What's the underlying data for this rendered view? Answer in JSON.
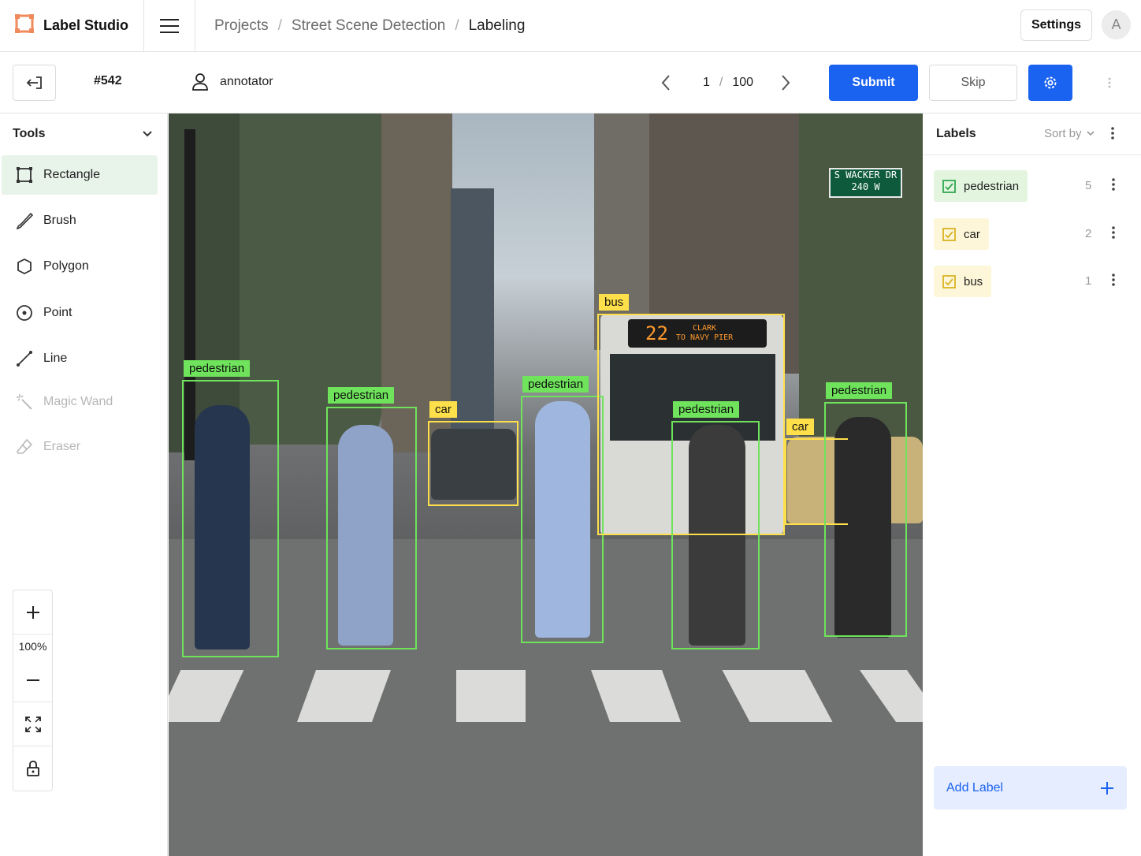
{
  "app": {
    "name": "Label Studio"
  },
  "breadcrumb": {
    "items": [
      "Projects",
      "Street Scene Detection",
      "Labeling"
    ],
    "separator": "/"
  },
  "header": {
    "settings_label": "Settings",
    "avatar_initial": "A"
  },
  "toolbar": {
    "task_id": "#542",
    "annotator": "annotator",
    "current_page": "1",
    "page_separator": "/",
    "total_pages": "100",
    "submit_label": "Submit",
    "skip_label": "Skip"
  },
  "tools": {
    "header": "Tools",
    "items": [
      {
        "label": "Rectangle",
        "icon": "rectangle-icon",
        "state": "active"
      },
      {
        "label": "Brush",
        "icon": "brush-icon",
        "state": "normal"
      },
      {
        "label": "Polygon",
        "icon": "polygon-icon",
        "state": "normal"
      },
      {
        "label": "Point",
        "icon": "point-icon",
        "state": "normal"
      },
      {
        "label": "Line",
        "icon": "line-icon",
        "state": "normal"
      },
      {
        "label": "Magic Wand",
        "icon": "magic-wand-icon",
        "state": "disabled"
      },
      {
        "label": "Eraser",
        "icon": "eraser-icon",
        "state": "disabled"
      }
    ],
    "zoom_level": "100%"
  },
  "annotations": [
    {
      "label": "pedestrian"
    },
    {
      "label": "pedestrian"
    },
    {
      "label": "car"
    },
    {
      "label": "pedestrian"
    },
    {
      "label": "bus"
    },
    {
      "label": "pedestrian"
    },
    {
      "label": "car"
    },
    {
      "label": "pedestrian"
    }
  ],
  "scene_text": {
    "street_sign_line1": "S WACKER DR",
    "street_sign_line2": "240 W",
    "bus_route": "22",
    "bus_dest_1": "CLARK",
    "bus_dest_2": "TO NAVY PIER"
  },
  "labels_panel": {
    "title": "Labels",
    "sort_label": "Sort by",
    "items": [
      {
        "name": "pedestrian",
        "count": "5"
      },
      {
        "name": "car",
        "count": "2"
      },
      {
        "name": "bus",
        "count": "1"
      }
    ],
    "add_label": "Add Label"
  },
  "colors": {
    "accent": "#1a62f0",
    "pedestrian": "#6ee35b",
    "vehicle": "#ffe04a",
    "active_tool_bg": "#e8f3ea"
  }
}
